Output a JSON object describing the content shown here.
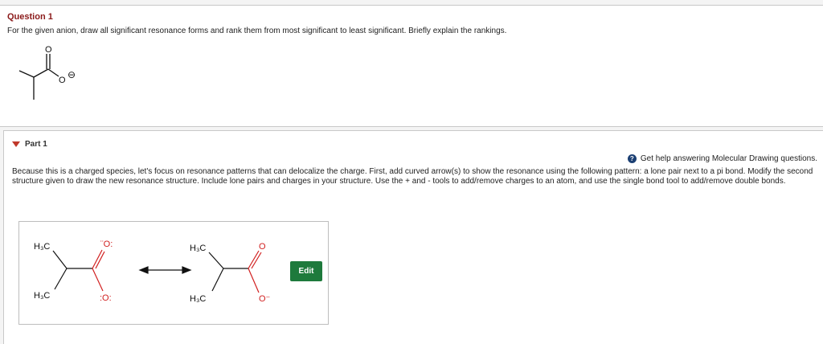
{
  "question": {
    "title": "Question 1",
    "text": "For the given anion, draw all significant resonance forms and rank them from most significant to least significant. Briefly explain the rankings.",
    "charge_symbol": "⊖"
  },
  "part": {
    "label": "Part 1",
    "help_text": "Get help answering Molecular Drawing questions.",
    "help_icon": "?",
    "instructions": "Because this is a charged species, let's focus on resonance patterns that can delocalize the charge. First, add curved arrow(s) to show the resonance using the following pattern: a lone pair next to a pi bond. Modify the second structure given to draw the new resonance structure. Include lone pairs and charges in your structure. Use the + and - tools to add/remove charges to an atom, and use the single bond tool to add/remove double bonds.",
    "edit_label": "Edit"
  },
  "structures": {
    "h3c": "H₃C",
    "o_lone": "¨O:",
    "o": "O",
    "o_minus": "O⁻",
    "o_dots": ":O:"
  },
  "colors": {
    "title": "#8b1a1a",
    "oxygen": "#d11f1f",
    "edit": "#1e7a3c",
    "help_icon": "#1b3f73"
  }
}
